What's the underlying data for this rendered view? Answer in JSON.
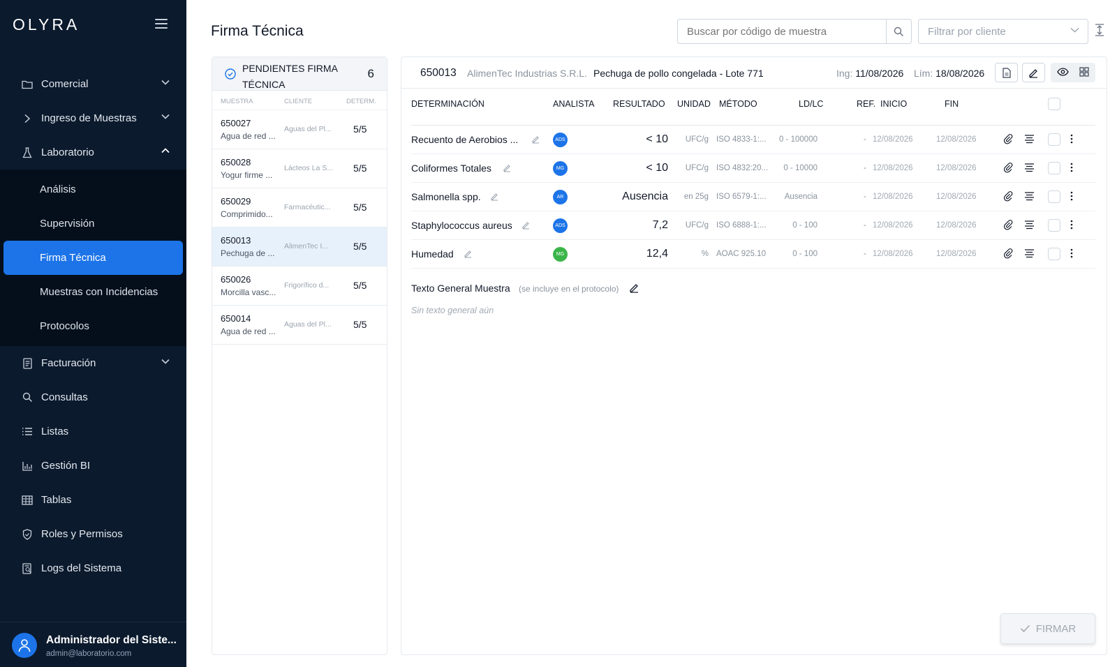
{
  "app": {
    "logo": "OLYRA"
  },
  "colors": {
    "sidebar_bg": "#0b1a2d",
    "accent": "#1d74e8",
    "selected_row": "#e7f1fb"
  },
  "sidebar": {
    "items": [
      {
        "label": "Comercial",
        "icon": "folder-icon",
        "expandable": true
      },
      {
        "label": "Ingreso de Muestras",
        "icon": "chevron-right-icon",
        "expandable": true
      },
      {
        "label": "Laboratorio",
        "icon": "flask-icon",
        "expanded": true,
        "children": [
          "Análisis",
          "Supervisión",
          "Firma Técnica",
          "Muestras con Incidencias",
          "Protocolos"
        ],
        "active_child": "Firma Técnica"
      },
      {
        "label": "Facturación",
        "icon": "receipt-icon",
        "expandable": true
      },
      {
        "label": "Consultas",
        "icon": "search-icon"
      },
      {
        "label": "Listas",
        "icon": "list-icon"
      },
      {
        "label": "Gestión BI",
        "icon": "bar-chart-icon"
      },
      {
        "label": "Tablas",
        "icon": "table-icon"
      },
      {
        "label": "Roles y Permisos",
        "icon": "shield-icon"
      },
      {
        "label": "Logs del Sistema",
        "icon": "log-icon"
      }
    ],
    "user": {
      "name": "Administrador del Siste...",
      "email": "admin@laboratorio.com"
    }
  },
  "header": {
    "title": "Firma Técnica",
    "search_placeholder": "Buscar por código de muestra",
    "filter_placeholder": "Filtrar por cliente"
  },
  "pending": {
    "title": "PENDIENTES FIRMA TÉCNICA",
    "count": "6",
    "columns": [
      "MUESTRA",
      "CLIENTE",
      "DETERM."
    ],
    "rows": [
      {
        "code": "650027",
        "desc": "Agua de red ...",
        "client": "Aguas del Pl...",
        "det": "5/5"
      },
      {
        "code": "650028",
        "desc": "Yogur firme ...",
        "client": "Lácteos La S...",
        "det": "5/5"
      },
      {
        "code": "650029",
        "desc": "Comprimido...",
        "client": "Farmacéutic...",
        "det": "5/5"
      },
      {
        "code": "650013",
        "desc": "Pechuga de ...",
        "client": "AlimenTec I...",
        "det": "5/5"
      },
      {
        "code": "650026",
        "desc": "Morcilla vasc...",
        "client": "Frigorífico d...",
        "det": "5/5"
      },
      {
        "code": "650014",
        "desc": "Agua de red ...",
        "client": "Aguas del Pl...",
        "det": "5/5"
      }
    ],
    "selected": "650013"
  },
  "detail": {
    "code": "650013",
    "client": "AlimenTec Industrias S.R.L.",
    "description": "Pechuga de pollo congelada - Lote 771",
    "ing_label": "Ing:",
    "ing_date": "11/08/2026",
    "lim_label": "Lím:",
    "lim_date": "18/08/2026",
    "columns": [
      "DETERMINACIÓN",
      "ANALISTA",
      "RESULTADO",
      "UNIDAD",
      "MÉTODO",
      "LD/LC",
      "REF.",
      "INICIO",
      "FIN"
    ],
    "rows": [
      {
        "name": "Recuento de Aerobios ...",
        "analyst": "ADS",
        "analyst_color": "#1d74e8",
        "result": "< 10",
        "unit": "UFC/g",
        "method": "ISO 4833-1:...",
        "ldlc": "0 - 100000",
        "ref": "-",
        "start": "12/08/2026",
        "end": "12/08/2026"
      },
      {
        "name": "Coliformes Totales",
        "analyst": "MG",
        "analyst_color": "#1d74e8",
        "result": "< 10",
        "unit": "UFC/g",
        "method": "ISO 4832:20...",
        "ldlc": "0 - 10000",
        "ref": "-",
        "start": "12/08/2026",
        "end": "12/08/2026"
      },
      {
        "name": "Salmonella spp.",
        "analyst": "AR",
        "analyst_color": "#1d74e8",
        "result": "Ausencia",
        "unit": "en 25g",
        "method": "ISO 6579-1:...",
        "ldlc": "Ausencia",
        "ref": "-",
        "start": "12/08/2026",
        "end": "12/08/2026"
      },
      {
        "name": "Staphylococcus aureus",
        "analyst": "ADS",
        "analyst_color": "#1d74e8",
        "result": "7,2",
        "unit": "UFC/g",
        "method": "ISO 6888-1:...",
        "ldlc": "0 - 100",
        "ref": "-",
        "start": "12/08/2026",
        "end": "12/08/2026"
      },
      {
        "name": "Humedad",
        "analyst": "MG",
        "analyst_color": "#3bb54a",
        "result": "12,4",
        "unit": "%",
        "method": "AOAC 925.10",
        "ldlc": "0 - 100",
        "ref": "-",
        "start": "12/08/2026",
        "end": "12/08/2026"
      }
    ],
    "general_title": "Texto General Muestra",
    "general_note": "(se incluye en el protocolo)",
    "general_empty": "Sin texto general aún",
    "sign_label": "FIRMAR"
  }
}
